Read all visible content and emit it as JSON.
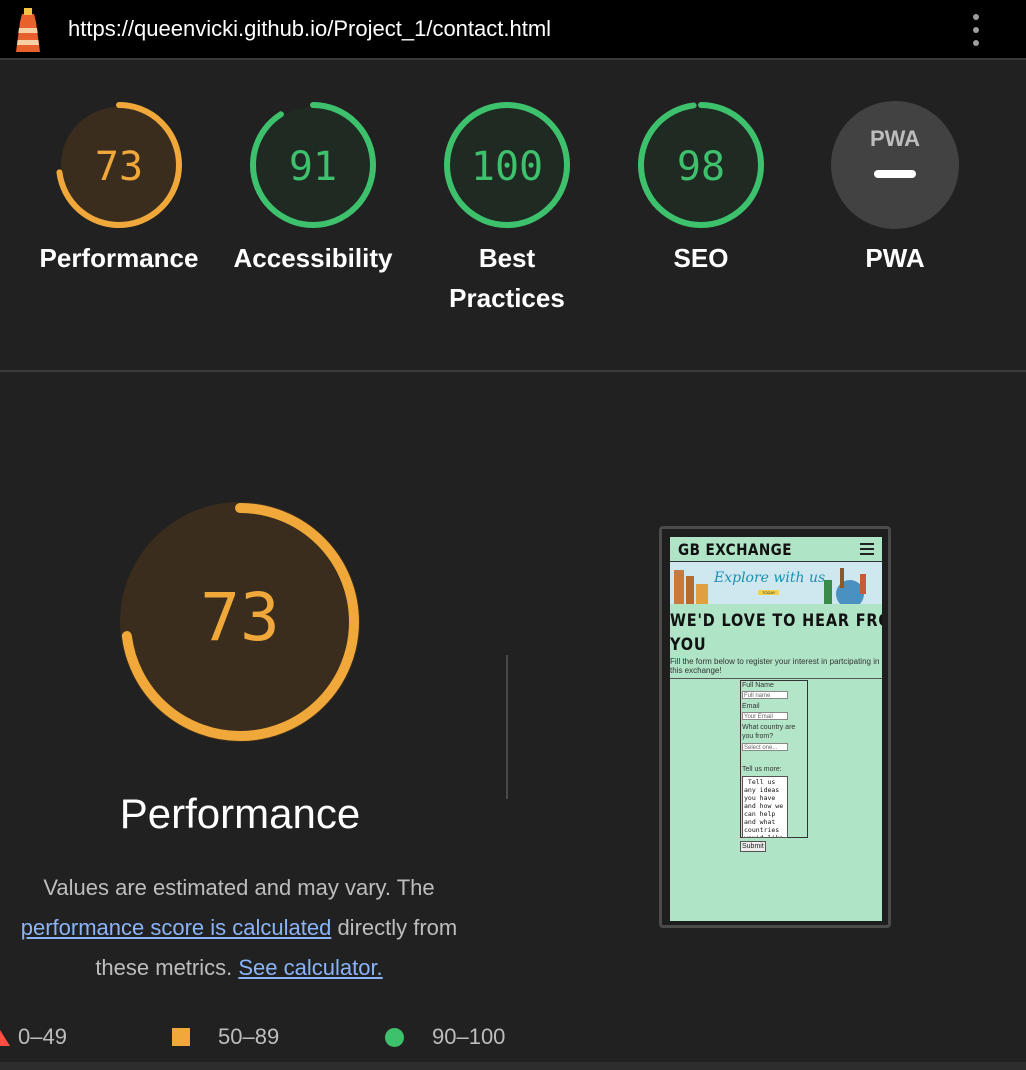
{
  "header": {
    "url": "https://queenvicki.github.io/Project_1/contact.html"
  },
  "colors": {
    "orange": "#f0a83a",
    "green": "#3ec16d",
    "background": "#212121"
  },
  "scores": [
    {
      "label": "Performance",
      "value": "73",
      "fraction": 0.73,
      "color": "#f0a83a",
      "fill": "#3a2d1d"
    },
    {
      "label": "Accessibility",
      "value": "91",
      "fraction": 0.91,
      "color": "#3ec16d",
      "fill": "#1f2a22"
    },
    {
      "label_line1": "Best",
      "label_line2": "Practices",
      "value": "100",
      "fraction": 1.0,
      "color": "#3ec16d",
      "fill": "#1f2a22"
    },
    {
      "label": "SEO",
      "value": "98",
      "fraction": 0.98,
      "color": "#3ec16d",
      "fill": "#1f2a22"
    },
    {
      "label": "PWA",
      "badge": "PWA",
      "icon": "pwa-dash-icon"
    }
  ],
  "detail": {
    "score": "73",
    "fraction": 0.73,
    "title": "Performance",
    "desc_prefix": "Values are estimated and may vary. The ",
    "desc_link": "performance score is calculated",
    "desc_middle": " directly from these metrics. ",
    "calc_link": "See calculator."
  },
  "legend": {
    "range_fail": "0–49",
    "range_average": "50–89",
    "range_pass": "90–100"
  },
  "screenshot": {
    "brand": "GB EXCHANGE",
    "banner": "Explore with us",
    "banner_sub": "TODAY",
    "heading_line1": "WE'D LOVE TO HEAR FROM",
    "heading_line2": "YOU",
    "intro": "Fill the form below to register your interest in partcipating in this exchange!",
    "full_name_label": "Full Name",
    "full_name_placeholder": "Full name",
    "email_label": "Email",
    "email_placeholder": "Your Email",
    "country_label": "What country are you from?",
    "country_select": "Select one...",
    "more_label": "Tell us more:",
    "more_text": " Tell us\nany ideas\nyou have\nand how we\ncan help\nand what\ncountries\nyou'd like",
    "submit": "Submit"
  }
}
